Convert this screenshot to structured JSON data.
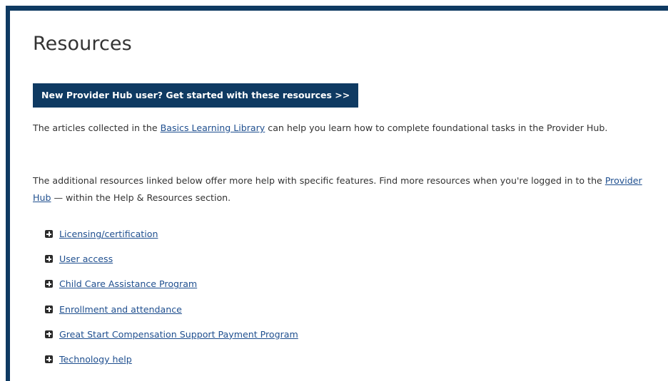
{
  "page": {
    "title": "Resources",
    "cta_label": "New Provider Hub user? Get started with these resources >>"
  },
  "intro": {
    "p1_before": "The articles collected in the ",
    "p1_link": "Basics Learning Library",
    "p1_after": " can help you learn how to complete foundational tasks in the Provider Hub.",
    "p2_before": "The additional resources linked below offer more help with specific features. Find more resources when you're logged in to the ",
    "p2_link": "Provider Hub",
    "p2_after": " — within the Help & Resources section."
  },
  "resources": [
    {
      "label": " Licensing/certification",
      "icon": "plus-square-icon"
    },
    {
      "label": " User access",
      "icon": "plus-square-icon"
    },
    {
      "label": " Child Care Assistance Program",
      "icon": "plus-square-icon"
    },
    {
      "label": " Enrollment and attendance",
      "icon": "plus-square-icon"
    },
    {
      "label": " Great Start Compensation Support Payment Program",
      "icon": "plus-square-icon"
    },
    {
      "label": " Technology help",
      "icon": "plus-square-icon"
    }
  ],
  "colors": {
    "brand_navy": "#0f3a62",
    "link_blue": "#1f4f8f",
    "body_text": "#333333"
  }
}
